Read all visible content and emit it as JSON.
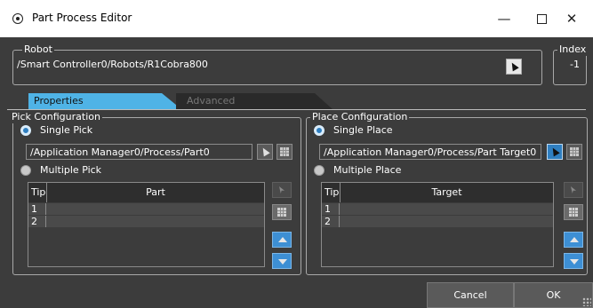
{
  "window": {
    "title": "Part Process Editor",
    "minimize_glyph": "—",
    "close_glyph": "✕"
  },
  "robot": {
    "legend": "Robot",
    "path": "/Smart Controller0/Robots/R1Cobra800"
  },
  "index": {
    "legend": "Index",
    "value": "-1"
  },
  "tabs": [
    {
      "label": "Properties",
      "active": true
    },
    {
      "label": "Advanced",
      "active": false
    }
  ],
  "pick": {
    "legend": "Pick Configuration",
    "single_label": "Single Pick",
    "single_selected": true,
    "path": "/Application Manager0/Process/Part0",
    "multiple_label": "Multiple Pick",
    "table": {
      "columns": [
        "Tip",
        "Part"
      ],
      "rows": [
        {
          "tip": "1",
          "value": ""
        },
        {
          "tip": "2",
          "value": ""
        }
      ]
    }
  },
  "place": {
    "legend": "Place Configuration",
    "single_label": "Single Place",
    "single_selected": true,
    "path": "/Application Manager0/Process/Part Target0",
    "multiple_label": "Multiple Place",
    "table": {
      "columns": [
        "Tip",
        "Target"
      ],
      "rows": [
        {
          "tip": "1",
          "value": ""
        },
        {
          "tip": "2",
          "value": ""
        }
      ]
    }
  },
  "footer": {
    "cancel_label": "Cancel",
    "ok_label": "OK"
  },
  "colors": {
    "background": "#3c3c3c",
    "tab_active": "#4fb3e6",
    "radio_selected": "#2f7fc1",
    "titlebar": "#ffffff"
  },
  "icons": [
    "app-icon",
    "minimize-icon",
    "maximize-icon",
    "close-icon",
    "select-cursor-icon",
    "browse-grid-icon",
    "arrow-up-icon",
    "arrow-down-icon",
    "resize-grip-icon"
  ]
}
